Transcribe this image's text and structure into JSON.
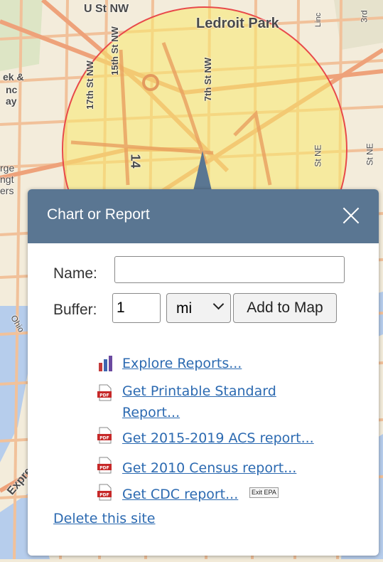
{
  "map": {
    "labels": {
      "u_st": "U St NW",
      "ledroit": "Ledroit Park",
      "fifteenth": "15th St NW",
      "seventeenth": "17th St NW",
      "seventh": "7th St NW",
      "fourteenth": "14",
      "third": "3rd",
      "lincoln": "Linc",
      "st_ne1": "St NE",
      "st_ne2": "St NE",
      "ek": "ek &",
      "nc": "nc",
      "ay": "ay",
      "rge": "rge",
      "ngt": "ngt",
      "ers": "ers",
      "ohio": "Ohio",
      "expr": "Expre"
    }
  },
  "popup": {
    "title": "Chart or Report",
    "name_label": "Name:",
    "name_value": "",
    "buffer_label": "Buffer:",
    "buffer_value": "1",
    "unit_value": "mi",
    "add_button": "Add to Map",
    "links": {
      "explore": "Explore Reports...",
      "printable_line1": "Get Printable Standard",
      "printable_line2": "Report...",
      "acs": "Get 2015-2019 ACS report...",
      "census": "Get 2010 Census report...",
      "cdc": "Get CDC report..."
    },
    "exit_badge": "Exit EPA",
    "delete": "Delete this site"
  },
  "colors": {
    "header": "#5a7692",
    "link": "#2c6ab1",
    "buffer_fill": "#f7ea6e",
    "buffer_stroke": "#e8494a"
  }
}
